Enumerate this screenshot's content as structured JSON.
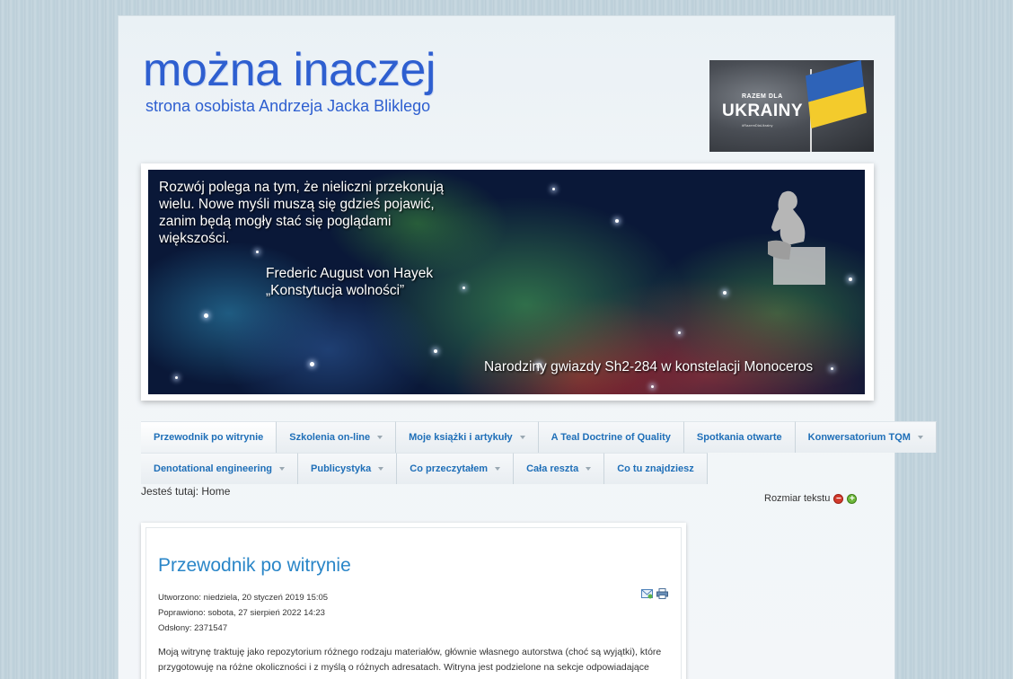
{
  "site": {
    "title": "można inaczej",
    "subtitle": "strona osobista Andrzeja Jacka Bliklego"
  },
  "ukraine_banner": {
    "line1": "RAZEM DLA",
    "line2": "UKRAINY",
    "tag": "#RazemDlaUkrainy"
  },
  "hero": {
    "quote": "Rozwój polega na tym, że nieliczni przekonują wielu. Nowe myśli muszą się gdzieś pojawić, zanim będą mogły stać się poglądami większości.",
    "author_line1": "Frederic August von Hayek",
    "author_line2": "„Konstytucja wolności”",
    "caption": "Narodziny gwiazdy Sh2-284 w konstelacji Monoceros"
  },
  "nav": {
    "row1": [
      {
        "label": "Przewodnik po witrynie",
        "dropdown": false,
        "active": true
      },
      {
        "label": "Szkolenia on-line",
        "dropdown": true
      },
      {
        "label": "Moje książki i artykuły",
        "dropdown": true
      },
      {
        "label": "A Teal Doctrine of Quality",
        "dropdown": false
      },
      {
        "label": "Spotkania otwarte",
        "dropdown": false
      },
      {
        "label": "Konwersatorium TQM",
        "dropdown": true
      }
    ],
    "row2": [
      {
        "label": "Denotational engineering",
        "dropdown": true
      },
      {
        "label": "Publicystyka",
        "dropdown": true
      },
      {
        "label": "Co przeczytałem",
        "dropdown": true
      },
      {
        "label": "Cała reszta",
        "dropdown": true
      },
      {
        "label": "Co tu znajdziesz",
        "dropdown": false
      }
    ]
  },
  "breadcrumb": {
    "prefix": "Jesteś tutaj:",
    "current": "Home"
  },
  "text_size": {
    "label": "Rozmiar tekstu"
  },
  "article": {
    "title": "Przewodnik po witrynie",
    "created": "Utworzono: niedziela, 20 styczeń 2019 15:05",
    "modified": "Poprawiono: sobota, 27 sierpień 2022 14:23",
    "hits": "Odsłony: 2371547",
    "body_line1": "Moją witrynę traktuję jako repozytorium różnego rodzaju materiałów, głównie własnego autorstwa (choć są wyjątki), które",
    "body_line2": "przygotowuję na różne okoliczności i z myślą o różnych adresatach. Witryna jest podzielone na sekcje odpowiadające"
  },
  "colors": {
    "title_blue": "#2e5fd0",
    "nav_text": "#1f6fb8",
    "article_title": "#2a86c8"
  }
}
